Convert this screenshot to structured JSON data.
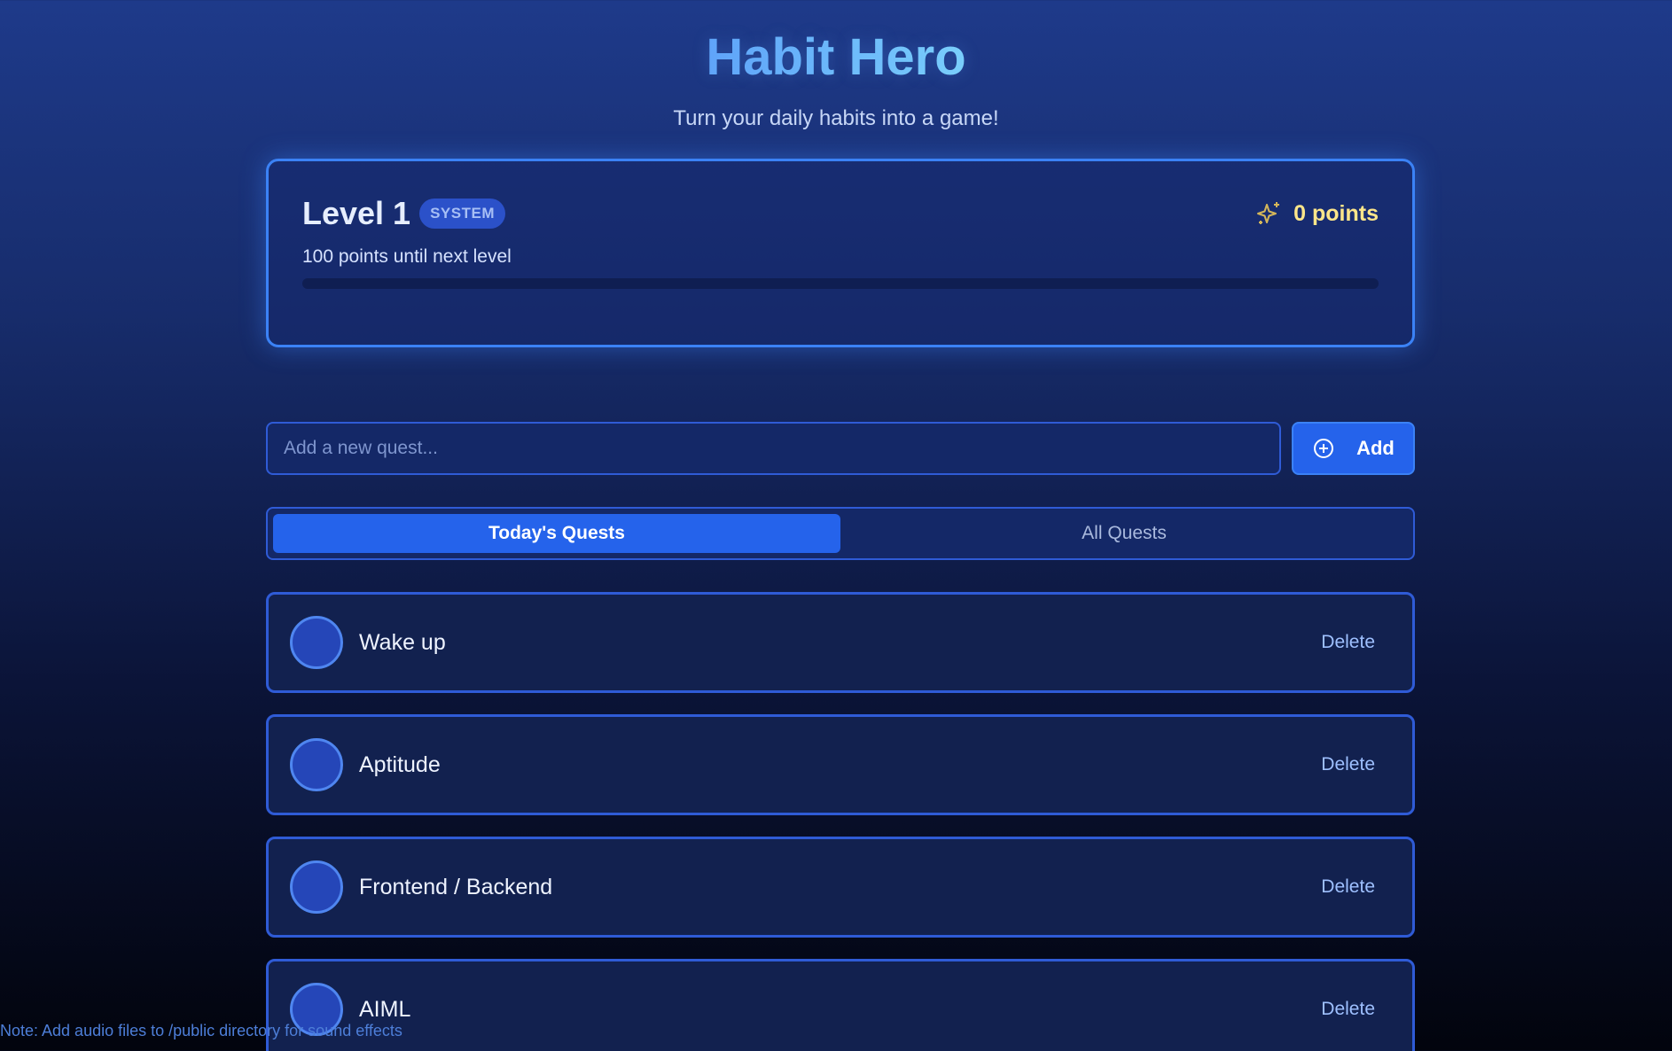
{
  "header": {
    "title": "Habit Hero",
    "subtitle": "Turn your daily habits into a game!"
  },
  "level": {
    "title": "Level 1",
    "badge": "SYSTEM",
    "points_label": "0 points",
    "next_level_text": "100 points until next level",
    "progress_fraction": 0,
    "points_icon": "sparkle-icon"
  },
  "add_quest": {
    "placeholder": "Add a new quest...",
    "button_label": "Add",
    "button_icon": "plus-circle-icon"
  },
  "tabs": [
    {
      "label": "Today's Quests",
      "active": true
    },
    {
      "label": "All Quests",
      "active": false
    }
  ],
  "quests": [
    {
      "name": "Wake up",
      "delete_label": "Delete"
    },
    {
      "name": "Aptitude",
      "delete_label": "Delete"
    },
    {
      "name": "Frontend / Backend",
      "delete_label": "Delete"
    },
    {
      "name": "AIML",
      "delete_label": "Delete"
    }
  ],
  "note": "Note: Add audio files to /public directory for sound effects",
  "colors": {
    "accent": "#3b82f6",
    "points": "#fde68a",
    "title_gradient_start": "#60a5fa",
    "title_gradient_end": "#7dd3fc"
  }
}
